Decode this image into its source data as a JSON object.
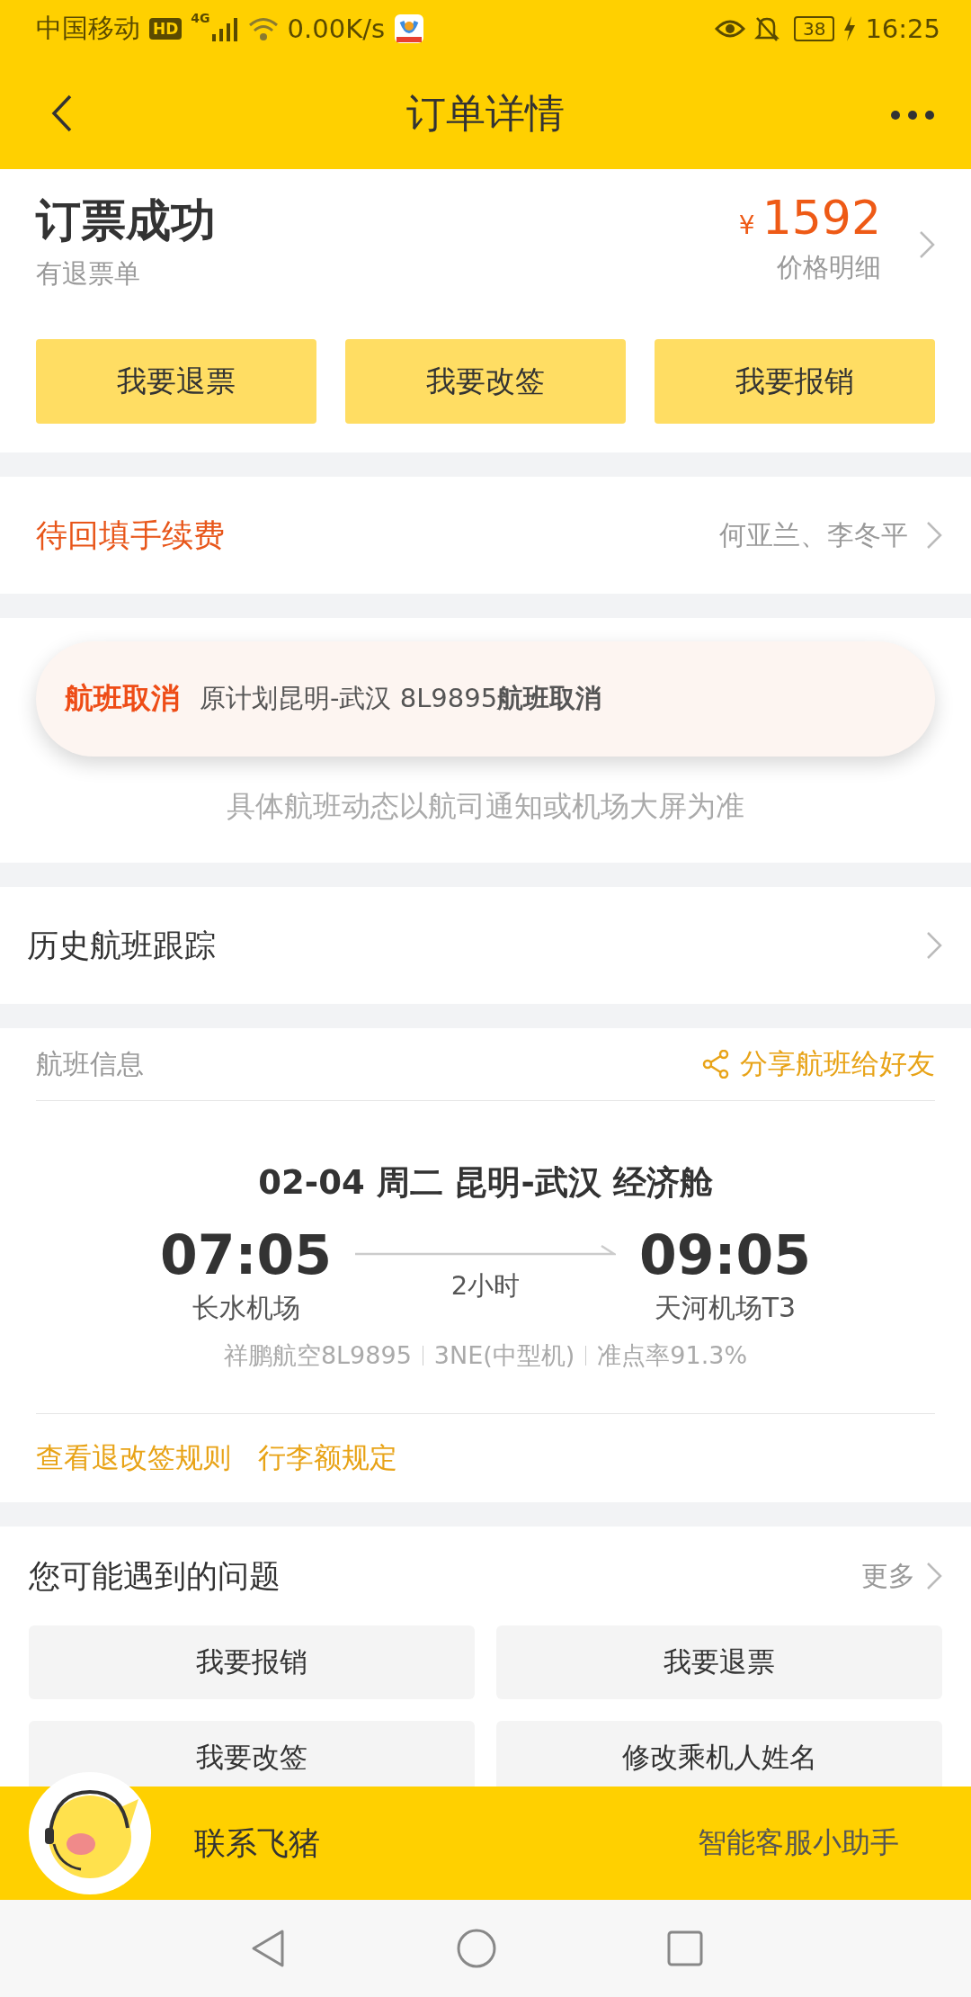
{
  "status_bar": {
    "carrier": "中国移动",
    "hd": "HD",
    "network": "4G",
    "speed": "0.00K/s",
    "battery": "38",
    "time": "16:25"
  },
  "header": {
    "title": "订单详情"
  },
  "order": {
    "status": "订票成功",
    "note": "有退票单",
    "currency": "¥",
    "price": "1592",
    "price_link": "价格明细",
    "actions": [
      "我要退票",
      "我要改签",
      "我要报销"
    ]
  },
  "pending": {
    "label": "待回填手续费",
    "names": "何亚兰、李冬平"
  },
  "notice": {
    "tag": "航班取消",
    "message": "原计划昆明-武汉 8L9895**航班取消**",
    "hint": "具体航班动态以航司通知或机场大屏为准"
  },
  "history": {
    "label": "历史航班跟踪"
  },
  "flight": {
    "section_title": "航班信息",
    "share": "分享航班给好友",
    "summary": "02-04  周二  昆明-武汉  经济舱",
    "depart_time": "07:05",
    "depart_airport": "长水机场",
    "duration": "2小时",
    "arrive_time": "09:05",
    "arrive_airport": "天河机场T3",
    "details": [
      "祥鹏航空8L9895",
      "3NE(中型机)",
      "准点率91.3%"
    ],
    "links": [
      "查看退改签规则",
      "行李额规定"
    ]
  },
  "questions": {
    "title": "您可能遇到的问题",
    "more": "更多",
    "items": [
      "我要报销",
      "我要退票",
      "我要改签",
      "修改乘机人姓名"
    ]
  },
  "contact_bar": {
    "label": "联系飞猪",
    "assistant": "智能客服小助手"
  }
}
